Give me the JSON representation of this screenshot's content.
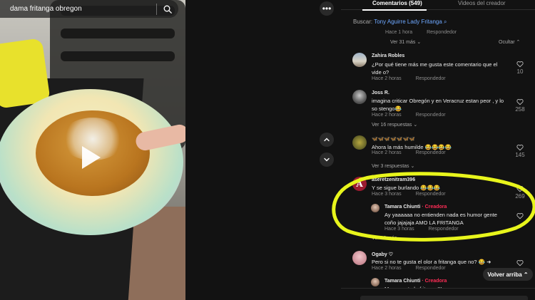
{
  "search": {
    "query": "dama fritanga obregon"
  },
  "tabs": [
    "Comentarios (549)",
    "Videos del creador"
  ],
  "buscar": {
    "label": "Buscar:",
    "term": "Tony Aguirre Lady Fritanga"
  },
  "prior": {
    "meta_time": "Hace 1 hora",
    "meta_reply": "Respondedor",
    "view_more": "Ver 31 más",
    "hide": "Ocultar"
  },
  "comments": [
    {
      "name": "Zahira Robles",
      "text": "¿Por qué tiene más me gusta este comentario que el vide o?",
      "time": "Hace 2 horas",
      "reply": "Respondedor",
      "likes": "10"
    },
    {
      "name": "Joss R.",
      "text": "imagina criticar Obregón y en Veracruz estan peor , y lo so stengo😂",
      "time": "Hace 2 horas",
      "reply": "Respondedor",
      "likes": "258",
      "replies": "Ver 16 respuestas"
    },
    {
      "name": "🦋🦋🦋🦋🦋🦋🦋",
      "text": "Ahora la más humilde 😂😂😂😂",
      "time": "Hace 2 horas",
      "reply": "Respondedor",
      "likes": "145",
      "replies": "Ver 3 respuestas"
    },
    {
      "name": "aseretzenitram396",
      "text": "Y se sigue burlando 😂😂😂",
      "time": "Hace 3 horas",
      "reply": "Respondedor",
      "likes": "269"
    },
    {
      "name": "Ogaby ♡",
      "text": "Pero si no te gusta el olor a fritanga que no? 😂 ➜",
      "time": "Hace 2 horas",
      "reply": "Respondedor",
      "likes": ""
    }
  ],
  "creator_reply": {
    "name": "Tamara Chiunti",
    "badge": "· Creadora",
    "text": "Ay yaaaaaa no entienden nada es humor gente coño jajajaja AMO LA FRITANGA",
    "time": "Hace 3 horas",
    "reply": "Respondedor",
    "more": "Ver 16 más"
  },
  "creator_reply2": {
    "name": "Tamara Chiunti",
    "badge": "· Creadora",
    "text": "Me encanta la fritanga!!!"
  },
  "back_to_top": "Volver arriba",
  "colors": {
    "accent_creator": "#fe2c55",
    "search_term": "#6ea8ff",
    "highlight": "#e8f51c",
    "background": "#121212"
  }
}
